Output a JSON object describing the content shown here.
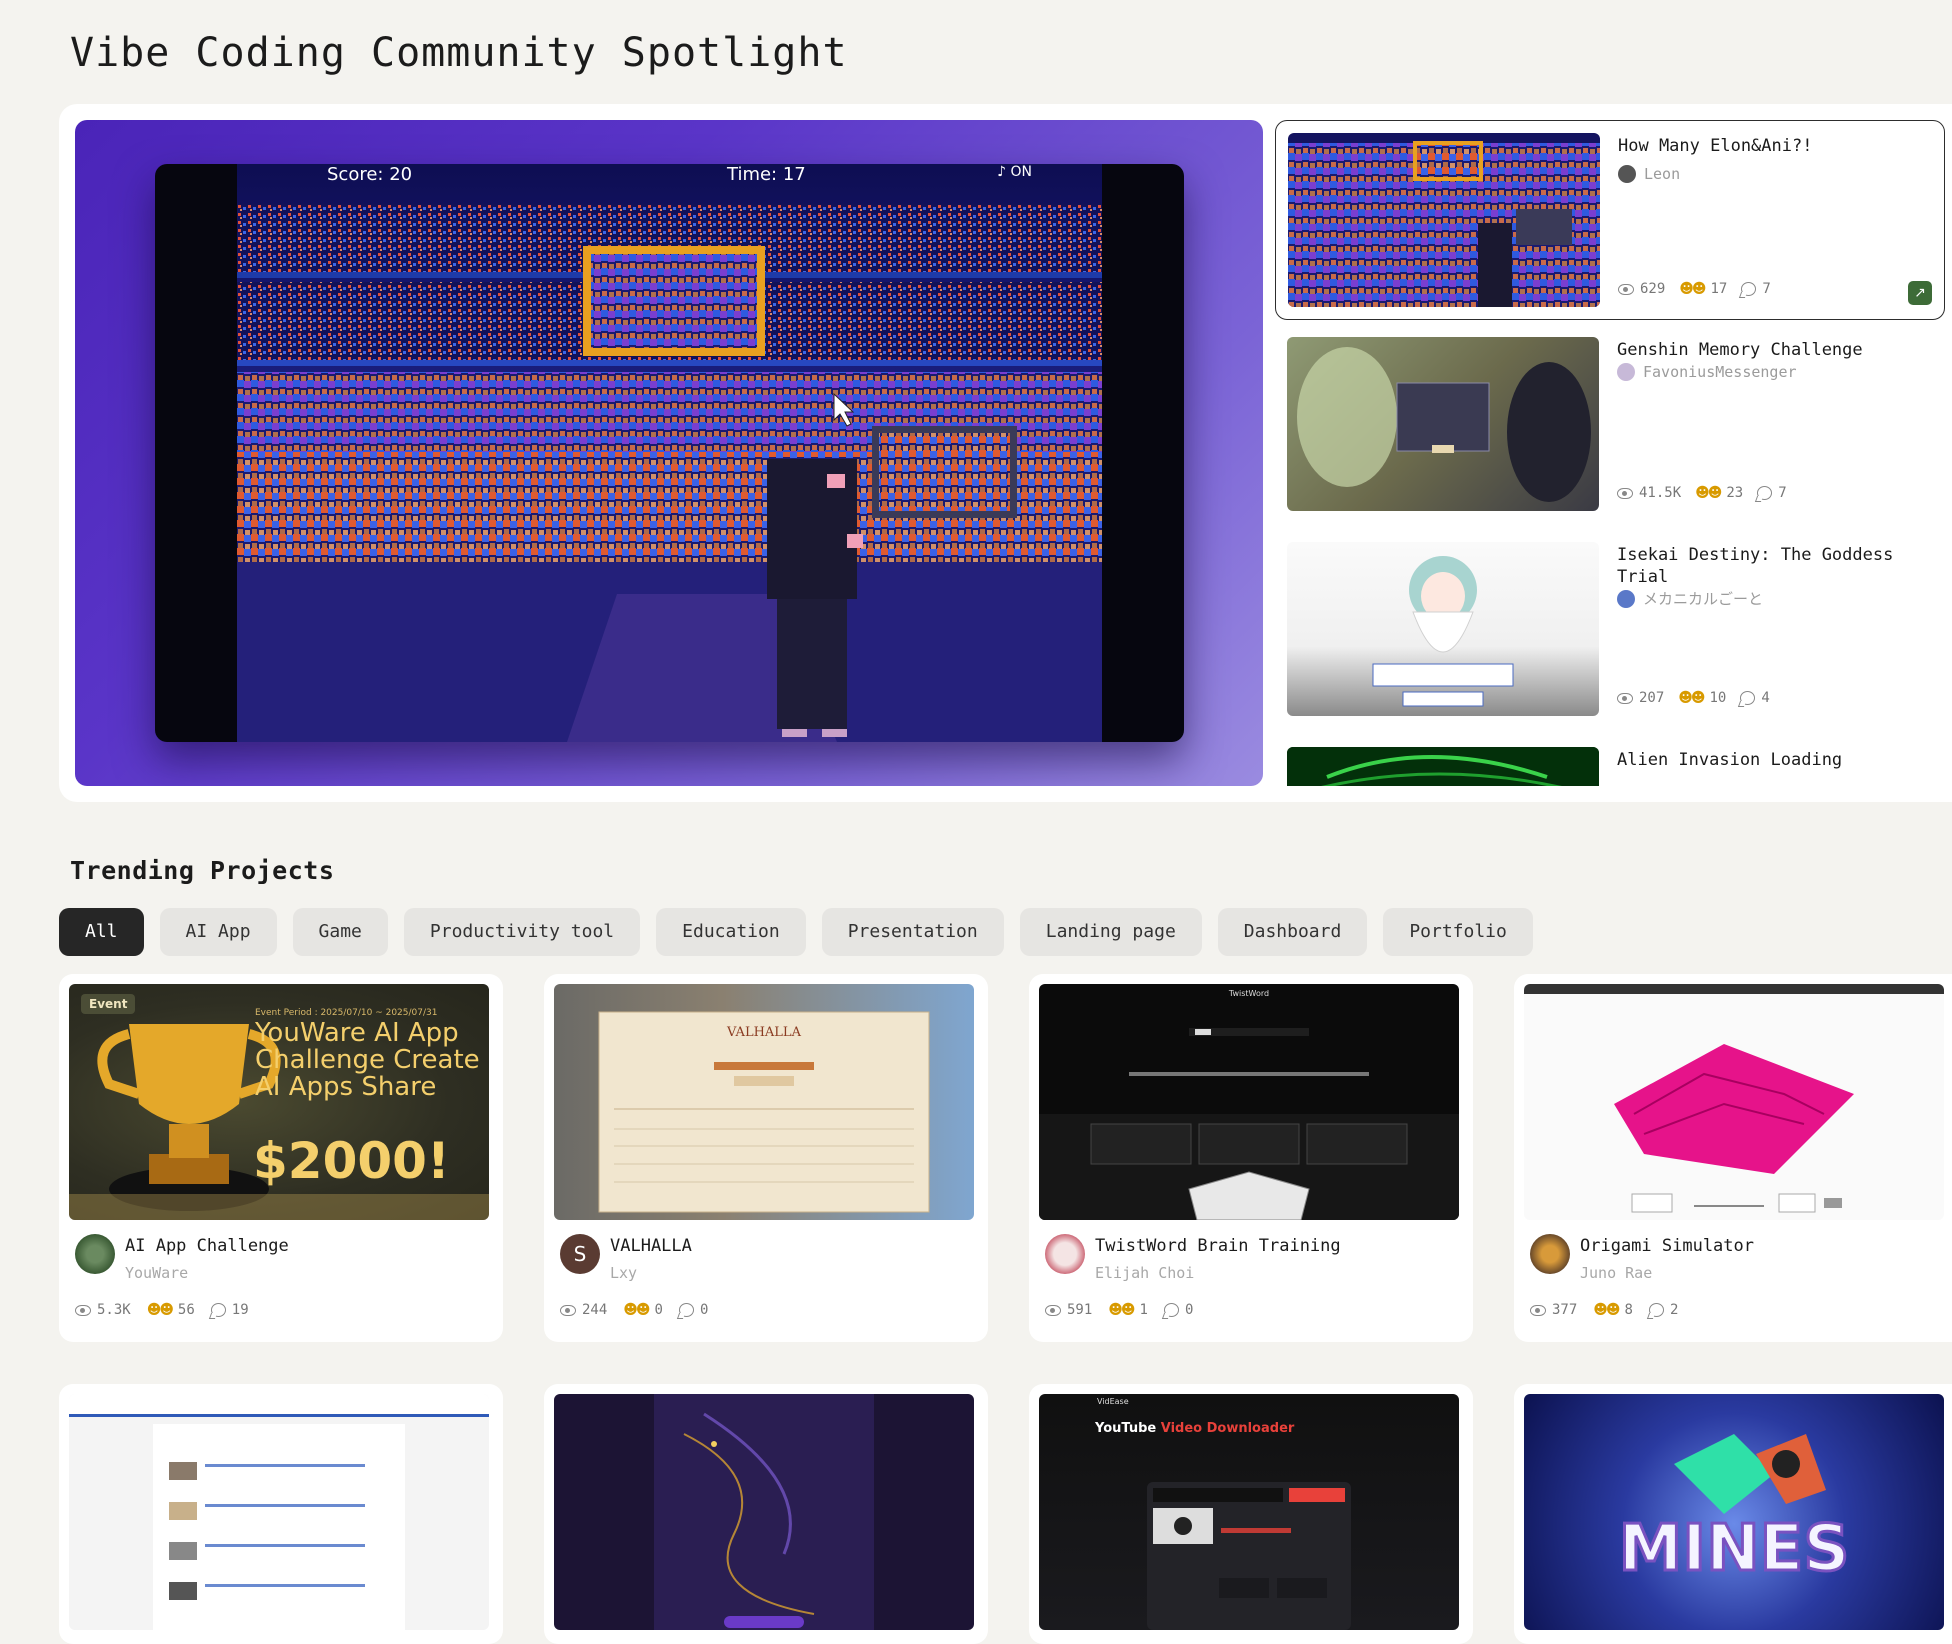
{
  "page_title": "Vibe Coding Community Spotlight",
  "hero": {
    "score": "Score: 20",
    "time": "Time: 17",
    "sound": "♪ ON"
  },
  "spotlight_list": [
    {
      "title": "How Many Elon&Ani?!",
      "author": "Leon",
      "views": "629",
      "likes": "17",
      "comments": "7",
      "active": true
    },
    {
      "title": "Genshin Memory Challenge",
      "author": "FavoniusMessenger",
      "views": "41.5K",
      "likes": "23",
      "comments": "7"
    },
    {
      "title": "Isekai Destiny: The Goddess Trial",
      "author": "メカニカルごーと",
      "views": "207",
      "likes": "10",
      "comments": "4"
    },
    {
      "title": "Alien Invasion Loading",
      "author": "",
      "views": "",
      "likes": "",
      "comments": ""
    }
  ],
  "trending": {
    "title": "Trending Projects",
    "filters": [
      "All",
      "AI App",
      "Game",
      "Productivity tool",
      "Education",
      "Presentation",
      "Landing page",
      "Dashboard",
      "Portfolio"
    ],
    "active_filter": "All",
    "cards": [
      {
        "title": "AI App Challenge",
        "author": "YouWare",
        "views": "5.3K",
        "likes": "56",
        "comments": "19",
        "badge": "Event",
        "period": "Event Period : 2025/07/10 ~ 2025/07/31",
        "headline": "YouWare AI App Challenge Create AI Apps Share",
        "prize": "$2000!"
      },
      {
        "title": "VALHALLA",
        "author": "Lxy",
        "views": "244",
        "likes": "0",
        "comments": "0",
        "avatar_letter": "S"
      },
      {
        "title": "TwistWord Brain Training",
        "author": "Elijah Choi",
        "views": "591",
        "likes": "1",
        "comments": "0"
      },
      {
        "title": "Origami Simulator",
        "author": "Juno Rae",
        "views": "377",
        "likes": "8",
        "comments": "2"
      }
    ],
    "thumb_labels": {
      "valhalla": "VALHALLA",
      "twistword": "TwistWord",
      "videase_brand": "VidEase",
      "videase_headline_a": "YouTube ",
      "videase_headline_b": "Video Downloader",
      "mines": "MINES"
    }
  },
  "colors": {
    "accent_dark": "#262626",
    "open_button": "#3d6b37",
    "event_gold": "#f4cf6c",
    "hero_purple": "#4a24b8"
  }
}
